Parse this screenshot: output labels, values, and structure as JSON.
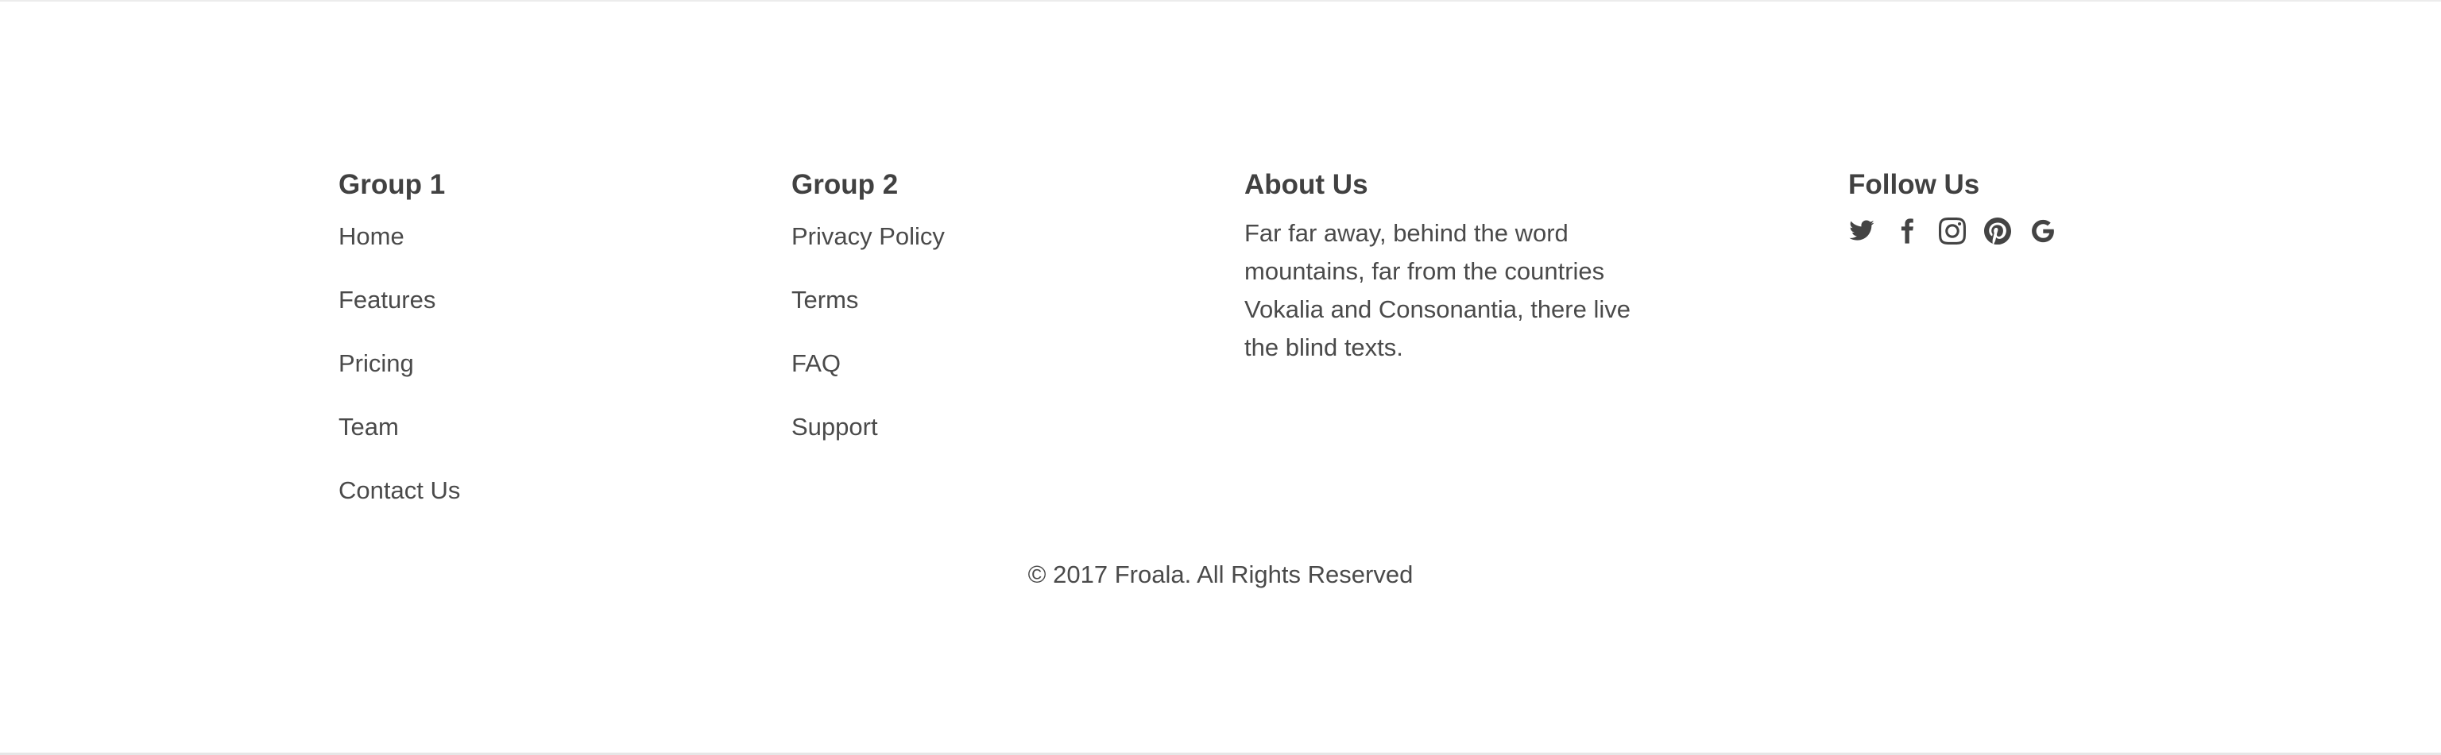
{
  "footer": {
    "group1": {
      "heading": "Group 1",
      "links": [
        "Home",
        "Features",
        "Pricing",
        "Team",
        "Contact Us"
      ]
    },
    "group2": {
      "heading": "Group 2",
      "links": [
        "Privacy Policy",
        "Terms",
        "FAQ",
        "Support"
      ]
    },
    "about": {
      "heading": "About Us",
      "text": "Far far away, behind the word mountains, far from the countries Vokalia and Consonantia, there live the blind texts."
    },
    "follow": {
      "heading": "Follow Us",
      "icons": [
        "twitter-icon",
        "facebook-icon",
        "instagram-icon",
        "pinterest-icon",
        "google-icon"
      ]
    },
    "copyright": "© 2017 Froala. All Rights Reserved"
  },
  "colors": {
    "text": "#4a4a4a",
    "heading": "#414141",
    "icon": "#444444",
    "rule": "#ececec"
  }
}
